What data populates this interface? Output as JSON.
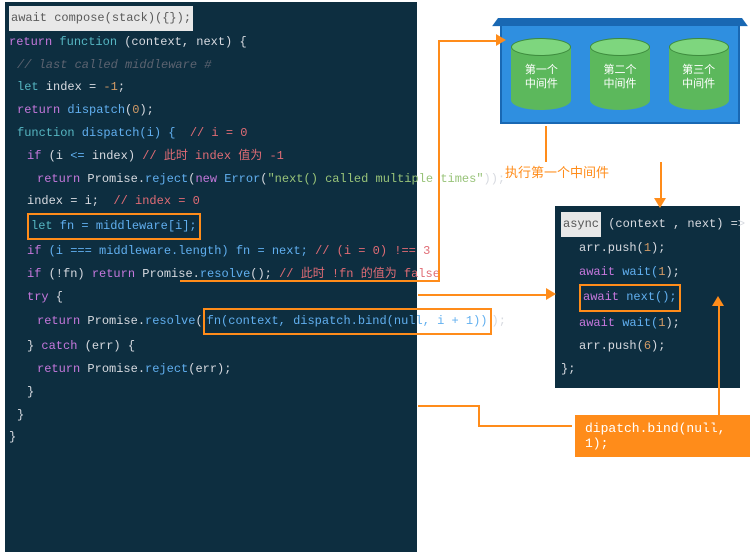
{
  "main_code": {
    "title": "await compose(stack)({});",
    "line_return": "return",
    "line_function": "function",
    "line_context_next": " (context, next) {",
    "comment_last": "// last called middleware #",
    "let": "let",
    "index_decl": " index = ",
    "neg1": "-1",
    "semi": ";",
    "return2": "return",
    "dispatch": "dispatch",
    "zero": "0",
    "paren_close_semi": ");",
    "function2": "function",
    "dispatch_sig": " dispatch(i) {  ",
    "i_eq_0": "// i = 0",
    "if": "if",
    "cond1_a": " (i ",
    "lte": "<=",
    "cond1_b": " index) ",
    "comment_index_neg1": "// 此时 index 值为 -1",
    "return3": "return",
    "promise_reject": " Promise.",
    "reject": "reject",
    "new": "new",
    "error": " Error",
    "err_msg": "\"next() called multiple times\"",
    "close_call": "));",
    "index_assign": "index = i;  ",
    "comment_index_0": "// index = 0",
    "let2": "let",
    "fn_decl": " fn = middleware[i];",
    "if2": "if",
    "triple_eq": " (i === middleware.length) fn = next; ",
    "comment_i0_3": "// (i = 0) !== 3",
    "if3": "if",
    "not_fn": " (!fn) ",
    "return4": "return",
    "resolve": "resolve",
    "empty_call": "(); ",
    "comment_fn_false": "// 此时 !fn 的值为 false",
    "try": "try",
    "open_brace": " {",
    "return5": "return",
    "resolve_call": "fn(context, dispatch.bind(null, i + 1))",
    "catch": "catch",
    "err_param": " (err) {",
    "reject_err": "(err);",
    "close_brace": "}"
  },
  "stack": {
    "cyl1": "第一个\n中间件",
    "cyl2": "第二个\n中间件",
    "cyl3": "第三个\n中间件"
  },
  "anno_exec": "执行第一个中间件",
  "side_code": {
    "async": "async",
    "sig": " (context , next) => {",
    "arr_push1": "arr.push(",
    "one": "1",
    "close": ");",
    "await1": "await",
    "wait": " wait(",
    "next": " next();",
    "six": "6",
    "close_brace": "};"
  },
  "dispatch_box": "dipatch.bind(null, 1);"
}
